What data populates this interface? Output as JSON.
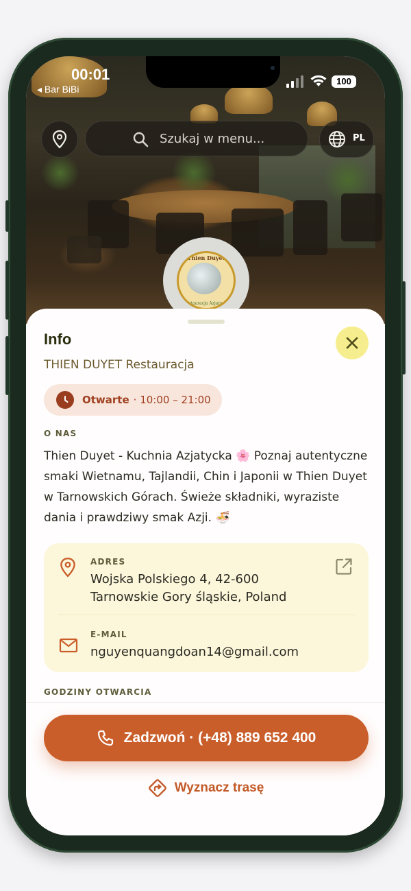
{
  "status_bar": {
    "time": "00:01",
    "back_label": "◂ Bar BiBi",
    "battery": "100"
  },
  "top_controls": {
    "search_placeholder": "Szukaj w menu...",
    "language": "PL",
    "icons": {
      "location": "map-pin-icon",
      "search": "search-icon",
      "language": "globe-icon"
    }
  },
  "logo": {
    "text": "Thien Duyet",
    "subtext": "Restauracja Azjatycka"
  },
  "sheet": {
    "title": "Info",
    "close_icon": "close-icon",
    "restaurant_name": "THIEN DUYET Restauracja",
    "hours": {
      "status": "Otwarte",
      "range": "· 10:00 – 21:00"
    },
    "about_heading": "O NAS",
    "about_text": "Thien Duyet - Kuchnia Azjatycka 🌸 Poznaj autentyczne smaki Wietnamu, Tajlandii, Chin i Japonii w Thien Duyet w Tarnowskich Górach. Świeże składniki, wyraziste dania i prawdziwy smak Azji. 🍜",
    "address": {
      "label": "ADRES",
      "line1": "Wojska Polskiego 4, 42-600",
      "line2": "Tarnowskie Gory śląskie, Poland"
    },
    "email": {
      "label": "E-MAIL",
      "value": "nguyenquangdoan14@gmail.com"
    },
    "opening_hours_heading": "GODZINY OTWARCIA",
    "call_button": "Zadzwoń · (+48) 889 652 400",
    "route_button": "Wyznacz trasę"
  },
  "colors": {
    "accent": "#c95e2a",
    "close_bg": "#f6ee8e",
    "card_bg": "#fcf7db",
    "pill_bg": "#f8e5dc",
    "title": "#2a2f10"
  }
}
